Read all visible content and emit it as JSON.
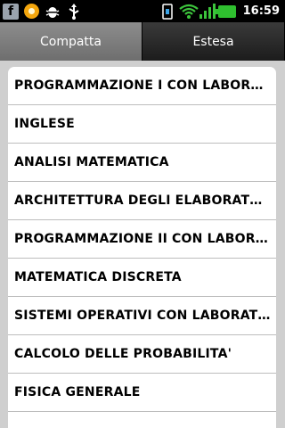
{
  "statusbar": {
    "left_icons": [
      "facebook-icon",
      "sun-app-icon",
      "android-debug-icon",
      "usb-icon"
    ],
    "right_icons": [
      "sim-card-icon",
      "wifi-icon",
      "signal-icon",
      "battery-icon"
    ],
    "clock": "16:59"
  },
  "tabs": [
    {
      "label": "Compatta",
      "active": true
    },
    {
      "label": "Estesa",
      "active": false
    }
  ],
  "courses": [
    "PROGRAMMAZIONE I CON LABORATORIO",
    "INGLESE",
    "ANALISI MATEMATICA",
    "ARCHITETTURA DEGLI ELABORATORI E LABORATORIO",
    "PROGRAMMAZIONE II CON LABORATORIO",
    "MATEMATICA DISCRETA",
    "SISTEMI OPERATIVI CON LABORATORIO",
    "CALCOLO DELLE PROBABILITA'",
    "FISICA GENERALE"
  ],
  "colors": {
    "accent_tab_active": "#7d7d7d",
    "list_background": "#ffffff",
    "frame_background": "#cfcfcf",
    "battery_green": "#2fbf2f"
  }
}
